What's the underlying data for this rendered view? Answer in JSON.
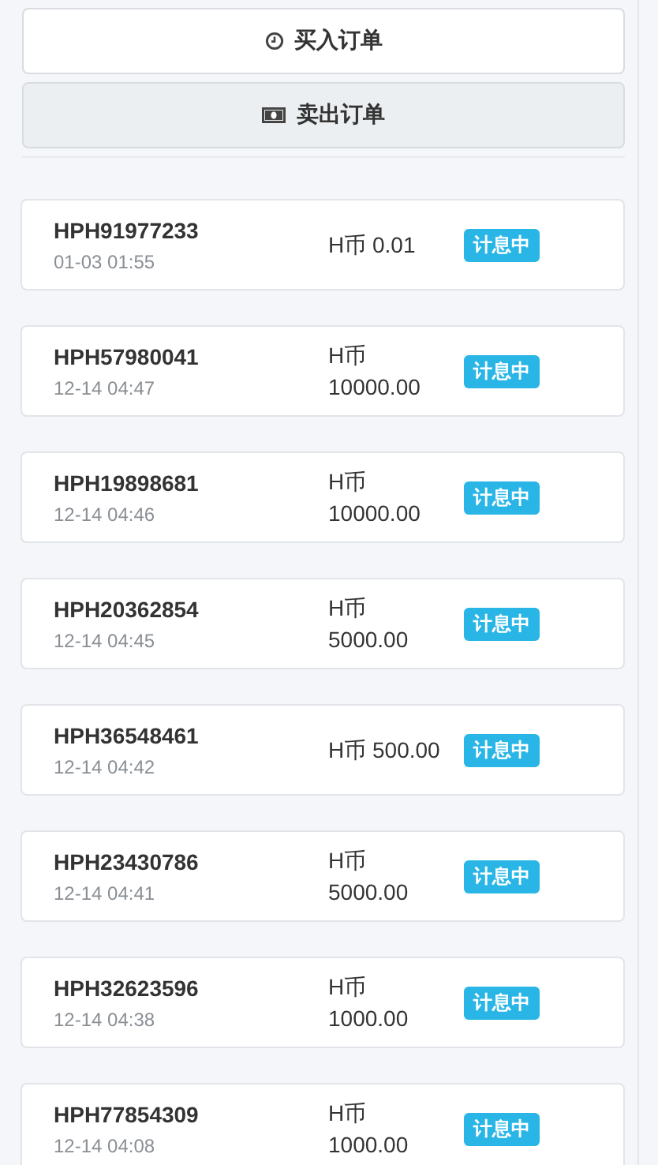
{
  "tabs": [
    {
      "label": "买入订单",
      "selected": false
    },
    {
      "label": "卖出订单",
      "selected": true
    }
  ],
  "orders": [
    {
      "id": "HPH91977233",
      "time": "01-03 01:55",
      "amount": "H币 0.01",
      "status": "计息中"
    },
    {
      "id": "HPH57980041",
      "time": "12-14 04:47",
      "amount": "H币 10000.00",
      "status": "计息中"
    },
    {
      "id": "HPH19898681",
      "time": "12-14 04:46",
      "amount": "H币 10000.00",
      "status": "计息中"
    },
    {
      "id": "HPH20362854",
      "time": "12-14 04:45",
      "amount": "H币 5000.00",
      "status": "计息中"
    },
    {
      "id": "HPH36548461",
      "time": "12-14 04:42",
      "amount": "H币 500.00",
      "status": "计息中"
    },
    {
      "id": "HPH23430786",
      "time": "12-14 04:41",
      "amount": "H币 5000.00",
      "status": "计息中"
    },
    {
      "id": "HPH32623596",
      "time": "12-14 04:38",
      "amount": "H币 1000.00",
      "status": "计息中"
    },
    {
      "id": "HPH77854309",
      "time": "12-14 04:08",
      "amount": "H币 1000.00",
      "status": "计息中"
    }
  ]
}
